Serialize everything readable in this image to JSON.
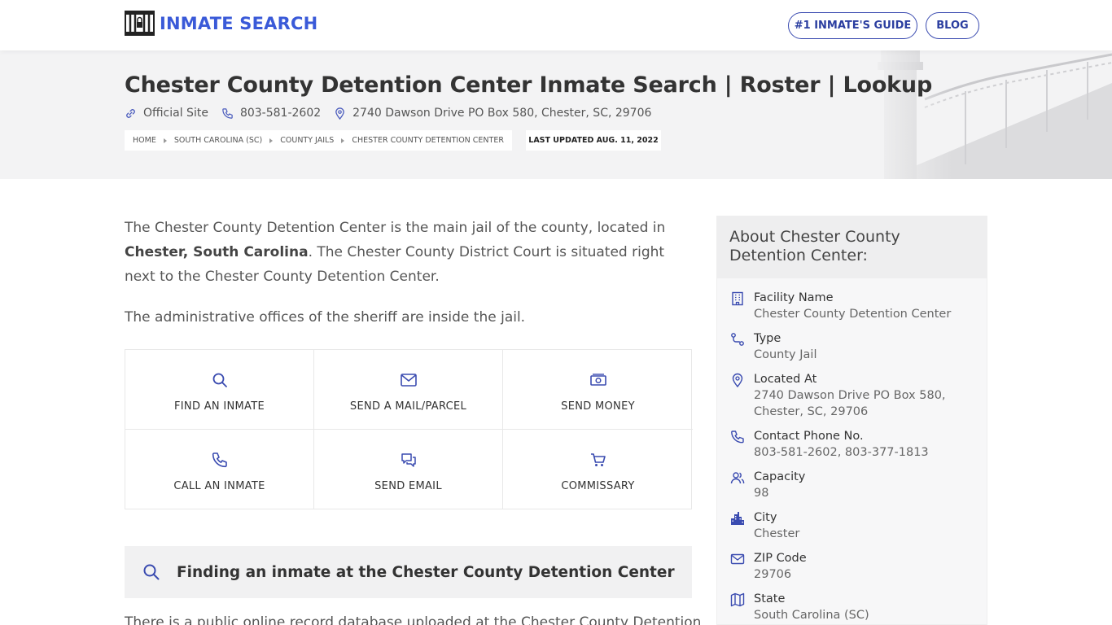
{
  "header": {
    "logo_text": "INMATE SEARCH",
    "nav": [
      {
        "label": "#1 INMATE'S GUIDE"
      },
      {
        "label": "BLOG"
      }
    ]
  },
  "hero": {
    "title": "Chester County Detention Center Inmate Search | Roster | Lookup",
    "official_site": "Official Site",
    "phone": "803-581-2602",
    "address": "2740 Dawson Drive PO Box 580, Chester, SC, 29706",
    "breadcrumbs": [
      "HOME",
      "SOUTH CAROLINA (SC)",
      "COUNTY JAILS",
      "CHESTER COUNTY DETENTION CENTER"
    ],
    "last_updated": "LAST UPDATED AUG. 11, 2022"
  },
  "main": {
    "p1_a": "The Chester County Detention Center is the main jail of the county, located in ",
    "p1_b": "Chester, South Carolina",
    "p1_c": ". The Chester County District Court is situated right next to the Chester County Detention Center.",
    "p2": "The administrative offices of the sheriff are inside the jail.",
    "actions": [
      {
        "label": "FIND AN INMATE"
      },
      {
        "label": "SEND A MAIL/PARCEL"
      },
      {
        "label": "SEND MONEY"
      },
      {
        "label": "CALL AN INMATE"
      },
      {
        "label": "SEND EMAIL"
      },
      {
        "label": "COMMISSARY"
      }
    ],
    "find_title": "Finding an inmate at the Chester County Detention Center",
    "p3": "There is a public online record database uploaded at the Chester County Detention"
  },
  "sidebar": {
    "title": "About Chester County Detention Center:",
    "items": [
      {
        "label": "Facility Name",
        "value": "Chester County Detention Center"
      },
      {
        "label": "Type",
        "value": "County Jail"
      },
      {
        "label": "Located At",
        "value": "2740 Dawson Drive PO Box 580, Chester, SC, 29706"
      },
      {
        "label": "Contact Phone No.",
        "value": "803-581-2602, 803-377-1813"
      },
      {
        "label": "Capacity",
        "value": "98"
      },
      {
        "label": "City",
        "value": "Chester"
      },
      {
        "label": "ZIP Code",
        "value": "29706"
      },
      {
        "label": "State",
        "value": "South Carolina (SC)"
      }
    ]
  },
  "colors": {
    "accent": "#3a5ad8",
    "nav_border": "#3a4bb0",
    "hero_bg": "#f3f3f4"
  }
}
